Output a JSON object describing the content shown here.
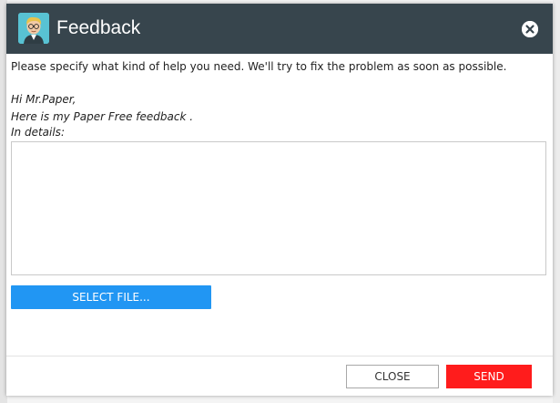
{
  "dialog": {
    "title": "Feedback",
    "intro": "Please specify what kind of help you need. We'll try to fix the problem as soon as possible.",
    "greeting": "Hi Mr.Paper,",
    "feedback_line": "Here is my Paper Free feedback .",
    "details_label": "In details:",
    "details_value": "",
    "select_file_label": "SELECT FILE...",
    "close_label": "CLOSE",
    "send_label": "SEND",
    "close_icon": "close-circle-icon",
    "avatar_icon": "mr-paper-avatar"
  },
  "colors": {
    "titlebar": "#37454d",
    "avatar_bg": "#58c2d3",
    "select_file": "#2196f3",
    "send": "#ff1c1c"
  }
}
